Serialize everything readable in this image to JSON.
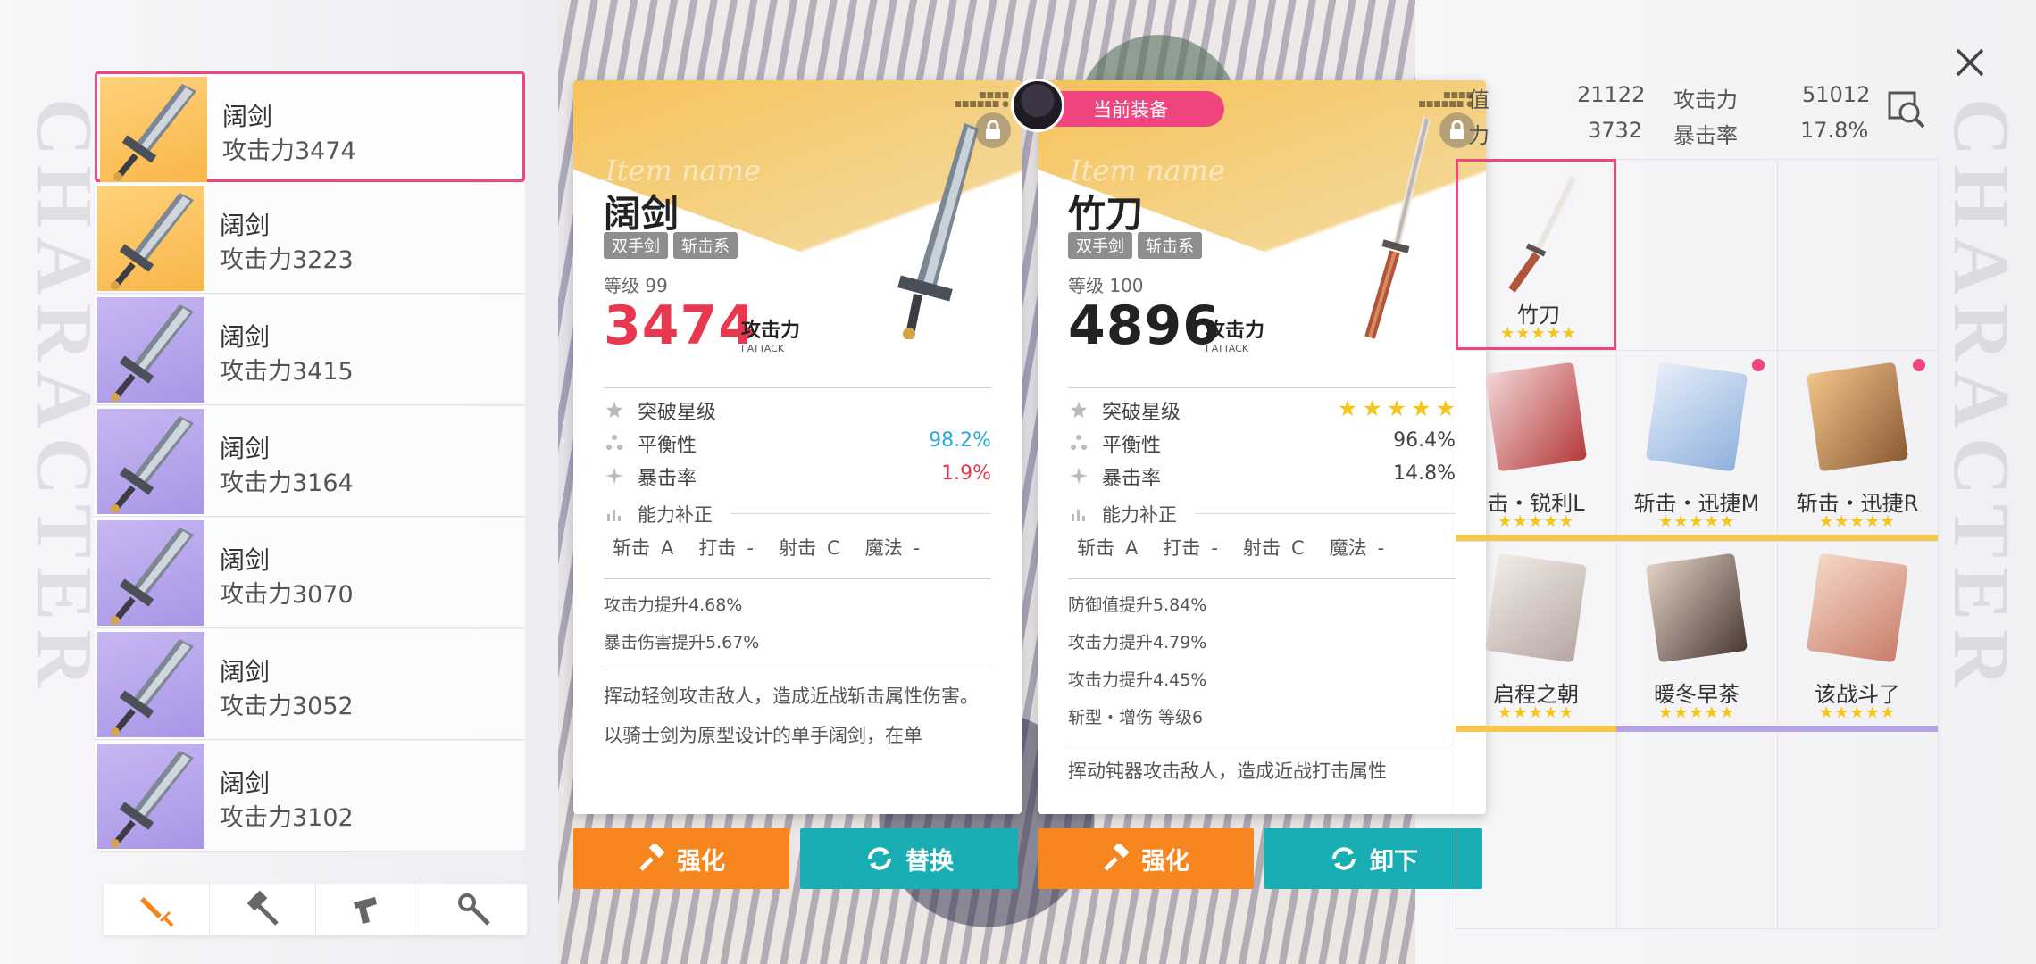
{
  "background": {
    "vertical_text": "CHARACTER"
  },
  "weapon_list": [
    {
      "name": "阔剑",
      "attack": "攻击力3474",
      "rarity": "gold",
      "selected": true
    },
    {
      "name": "阔剑",
      "attack": "攻击力3223",
      "rarity": "gold",
      "selected": false
    },
    {
      "name": "阔剑",
      "attack": "攻击力3415",
      "rarity": "purple",
      "selected": false
    },
    {
      "name": "阔剑",
      "attack": "攻击力3164",
      "rarity": "purple",
      "selected": false
    },
    {
      "name": "阔剑",
      "attack": "攻击力3070",
      "rarity": "purple",
      "selected": false
    },
    {
      "name": "阔剑",
      "attack": "攻击力3052",
      "rarity": "purple",
      "selected": false
    },
    {
      "name": "阔剑",
      "attack": "攻击力3102",
      "rarity": "purple",
      "selected": false
    }
  ],
  "category_tabs": [
    {
      "icon": "sword-icon",
      "active": true
    },
    {
      "icon": "hammer-icon",
      "active": false
    },
    {
      "icon": "gun-icon",
      "active": false
    },
    {
      "icon": "wand-icon",
      "active": false
    }
  ],
  "card_left": {
    "script": "Item name",
    "name": "阔剑",
    "tags": [
      "双手剑",
      "斩击系"
    ],
    "level": "等级 99",
    "attack_value": "3474",
    "attack_value_color": "#e8384f",
    "attack_label": "攻击力",
    "attack_en": "I ATTACK",
    "breakthrough_label": "突破星级",
    "balance_label": "平衡性",
    "balance_value": "98.2%",
    "balance_color": "#2aa8d8",
    "crit_label": "暴击率",
    "crit_value": "1.9%",
    "crit_color": "#e8384f",
    "ability_label": "能力补正",
    "grades": [
      {
        "k": "斩击",
        "v": "A"
      },
      {
        "k": "打击",
        "v": "-"
      },
      {
        "k": "射击",
        "v": "C"
      },
      {
        "k": "魔法",
        "v": "-"
      }
    ],
    "bonuses": [
      "攻击力提升4.68%",
      "暴击伤害提升5.67%"
    ],
    "desc1": "挥动轻剑攻击敌人，造成近战斩击属性伤害。",
    "desc2": "以骑士剑为原型设计的单手阔剑，在单"
  },
  "card_right": {
    "script": "Item name",
    "badge": "当前装备",
    "name": "竹刀",
    "tags": [
      "双手剑",
      "斩击系"
    ],
    "level": "等级 100",
    "attack_value": "4896",
    "attack_value_color": "#222222",
    "attack_label": "攻击力",
    "attack_en": "I ATTACK",
    "breakthrough_label": "突破星级",
    "breakthrough_stars": 5,
    "balance_label": "平衡性",
    "balance_value": "96.4%",
    "crit_label": "暴击率",
    "crit_value": "14.8%",
    "ability_label": "能力补正",
    "grades": [
      {
        "k": "斩击",
        "v": "A"
      },
      {
        "k": "打击",
        "v": "-"
      },
      {
        "k": "射击",
        "v": "C"
      },
      {
        "k": "魔法",
        "v": "-"
      }
    ],
    "bonuses": [
      "防御值提升5.84%",
      "攻击力提升4.79%",
      "攻击力提升4.45%",
      "斩型・增伤 等级6"
    ],
    "desc1": "挥动钝器攻击敌人，造成近战打击属性"
  },
  "buttons": {
    "left_enhance": "强化",
    "left_replace": "替换",
    "right_enhance": "强化",
    "right_unequip": "卸下"
  },
  "stats_panel": {
    "r1c1_label": "值",
    "r1c1_value": "21122",
    "r1c2_label": "攻击力",
    "r1c2_value": "51012",
    "r2c1_label": "力",
    "r2c1_value": "3732",
    "r2c2_label": "暴击率",
    "r2c2_value": "17.8%"
  },
  "equip_slots": [
    {
      "label": "竹刀",
      "stars": "★★★★★",
      "bar": "none",
      "dot": false,
      "selected": true
    },
    {
      "label": "击・锐利L",
      "stars": "★★★★★",
      "bar": "#f5c84a",
      "dot": false,
      "selected": false
    },
    {
      "label": "斩击・迅捷M",
      "stars": "★★★★★",
      "bar": "#f5c84a",
      "dot": true,
      "selected": false
    },
    {
      "label": "斩击・迅捷R",
      "stars": "★★★★★",
      "bar": "#f5c84a",
      "dot": true,
      "selected": false
    },
    {
      "label": "启程之朝",
      "stars": "★★★★★",
      "bar": "#f5c84a",
      "dot": false,
      "selected": false
    },
    {
      "label": "暖冬早茶",
      "stars": "★★★★★",
      "bar": "#b7a3ea",
      "dot": false,
      "selected": false
    },
    {
      "label": "该战斗了",
      "stars": "★★★★★",
      "bar": "#b7a3ea",
      "dot": false,
      "selected": false
    }
  ],
  "colors": {
    "accent_pink": "#f0457e",
    "orange": "#f7861f",
    "teal": "#18aeb3",
    "star": "#f5c518"
  }
}
